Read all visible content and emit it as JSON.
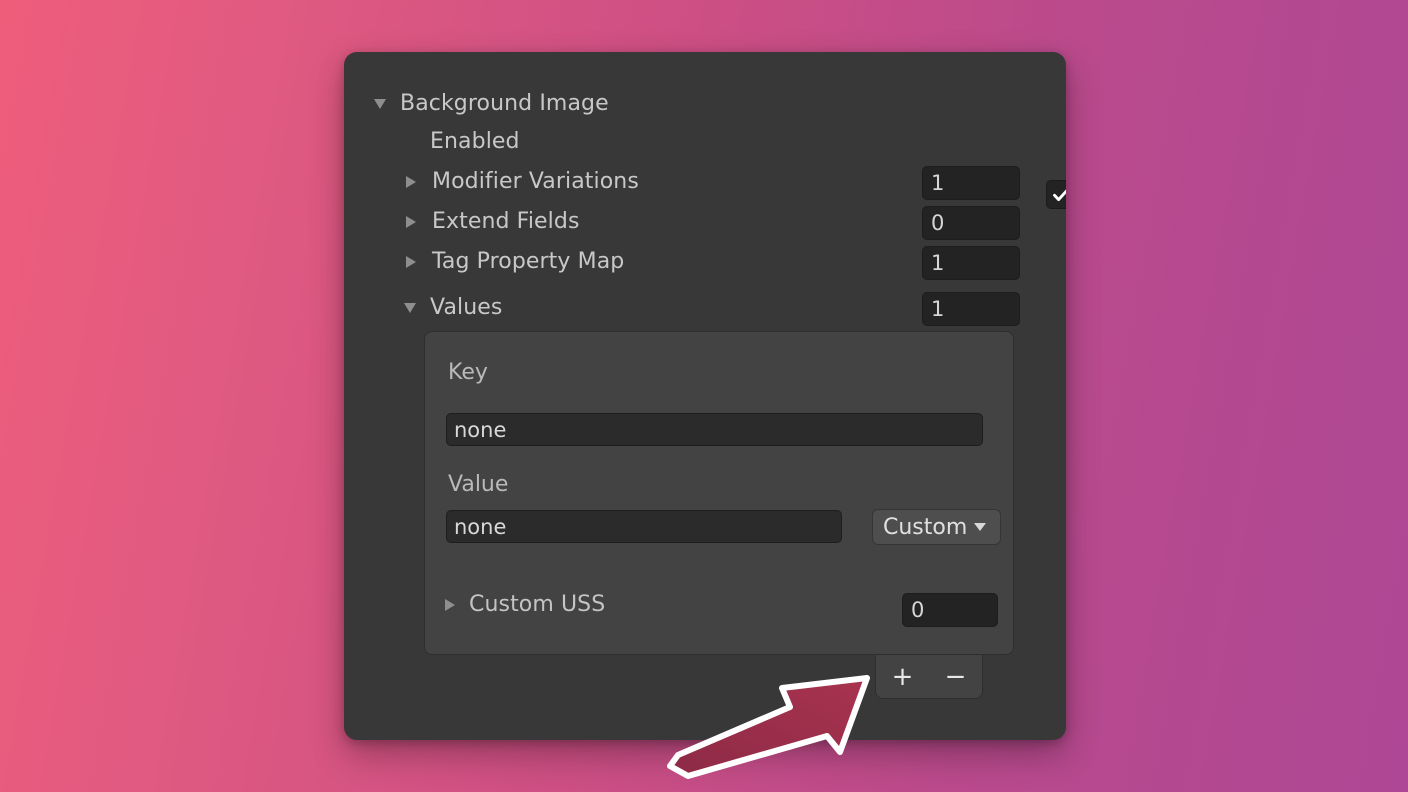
{
  "theme": {
    "background_gradient_from": "#ef5d7b",
    "background_gradient_to": "#ae4795",
    "panel_bg": "#383838",
    "inner_box_bg": "#434343",
    "field_bg": "#232323",
    "text_color": "#c8c8c8",
    "annotation_arrow_fill": "#9e2f4d",
    "annotation_arrow_stroke": "#ffffff"
  },
  "panel": {
    "header": {
      "label": "Background Image",
      "disclosure": "triangle-down-icon",
      "expanded": true
    },
    "rows": [
      {
        "label": "Enabled",
        "control": "checkbox",
        "checked": true,
        "disclosure": null
      },
      {
        "label": "Modifier Variations",
        "control": "number",
        "value": "1",
        "disclosure": "triangle-right-icon",
        "expanded": false
      },
      {
        "label": "Extend Fields",
        "control": "number",
        "value": "0",
        "disclosure": "triangle-right-icon",
        "expanded": false
      },
      {
        "label": "Tag Property Map",
        "control": "number",
        "value": "1",
        "disclosure": "triangle-right-icon",
        "expanded": false
      },
      {
        "label": "Values",
        "control": "number",
        "value": "1",
        "disclosure": "triangle-down-icon",
        "expanded": true
      }
    ],
    "values_box": {
      "key_label": "Key",
      "key_value": "none",
      "value_label": "Value",
      "value_value": "none",
      "value_dropdown": {
        "selected": "Custom",
        "chevron": "triangle-down-icon"
      },
      "custom_uss": {
        "label": "Custom USS",
        "disclosure": "triangle-right-icon",
        "expanded": false,
        "count": "0"
      }
    },
    "list_buttons": {
      "add_label": "+",
      "remove_label": "−"
    }
  },
  "annotation": {
    "type": "arrow",
    "points_to": "list-buttons",
    "direction": "up-right"
  }
}
